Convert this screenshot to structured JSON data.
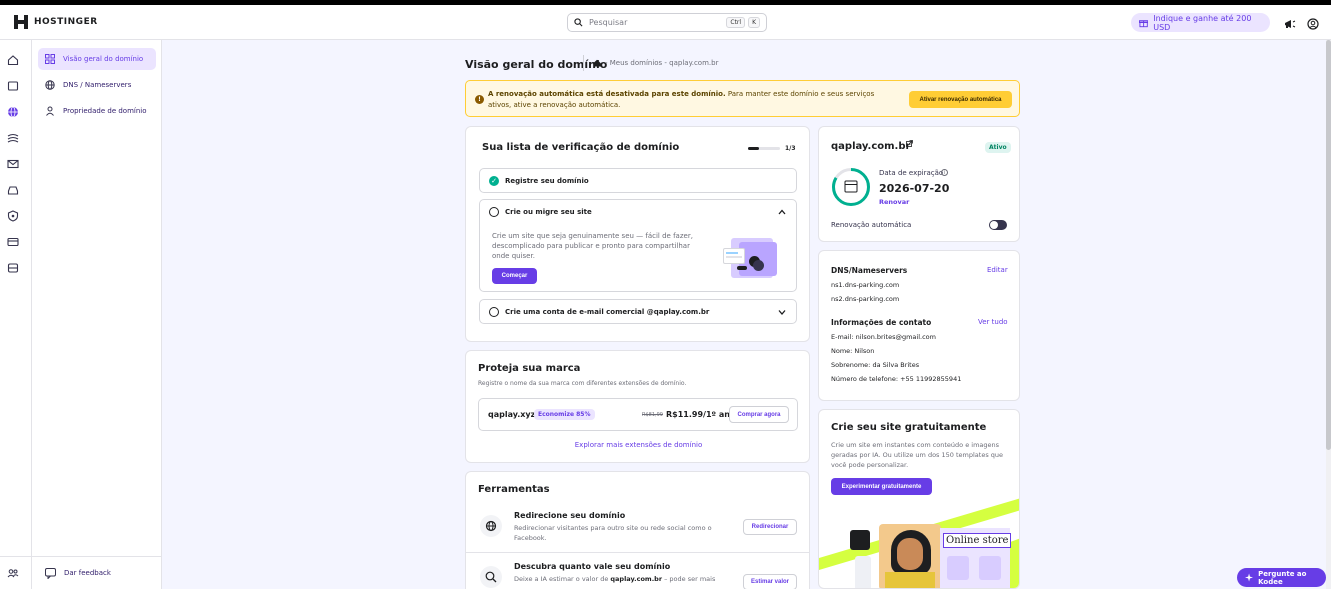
{
  "brand": {
    "name": "HOSTINGER"
  },
  "search": {
    "placeholder": "Pesquisar",
    "kbd1": "Ctrl",
    "kbd2": "K"
  },
  "topbar": {
    "refer_label": "Indique e ganhe até 200 USD"
  },
  "subnav": {
    "items": [
      {
        "label": "Visão geral do domínio",
        "active": true
      },
      {
        "label": "DNS / Nameservers",
        "active": false
      },
      {
        "label": "Propriedade de domínio",
        "active": false
      }
    ],
    "feedback": "Dar feedback"
  },
  "page": {
    "title": "Visão geral do domínio",
    "breadcrumb": "- Meus domínios - qaplay.com.br"
  },
  "alert": {
    "bold": "A renovação automática está desativada para este domínio.",
    "text": " Para manter este domínio e seus serviços ativos, ative a renovação automática.",
    "button": "Ativar renovação automática"
  },
  "checklist": {
    "title": "Sua lista de verificação de domínio",
    "progress_text": "1/3",
    "progress_fraction": 0.33,
    "steps": [
      {
        "label": "Registre seu domínio",
        "done": true
      },
      {
        "label": "Crie ou migre seu site",
        "done": false,
        "description": "Crie um site que seja genuinamente seu — fácil de fazer, descomplicado para publicar e pronto para compartilhar onde quiser.",
        "button": "Começar"
      },
      {
        "label": "Crie uma conta de e-mail comercial @qaplay.com.br",
        "done": false
      }
    ]
  },
  "brand_card": {
    "title": "Proteja sua marca",
    "subtitle": "Registre o nome da sua marca com diferentes extensões de domínio.",
    "domain": "qaplay.xyz",
    "badge": "Economize 85%",
    "old_price": "R$81,99",
    "price": "R$11.99/1º ano",
    "button": "Comprar agora",
    "explore": "Explorar mais extensões de domínio"
  },
  "tools": {
    "title": "Ferramentas",
    "items": [
      {
        "title": "Redirecione seu domínio",
        "desc": "Redirecionar visitantes para outro site ou rede social como o Facebook.",
        "button": "Redirecionar"
      },
      {
        "title": "Descubra quanto vale seu domínio",
        "desc_pre": "Deixe a IA estimar o valor de ",
        "desc_bold": "qaplay.com.br",
        "desc_post": " – pode ser mais",
        "button": "Estimar valor"
      }
    ]
  },
  "domain_card": {
    "domain": "qaplay.com.br",
    "status": "Ativo",
    "expiry_label": "Data de expiração",
    "expiry_date": "2026-07-20",
    "renew": "Renovar",
    "auto_renew_label": "Renovação automática"
  },
  "dns_card": {
    "title": "DNS/Nameservers",
    "edit": "Editar",
    "ns1": "ns1.dns-parking.com",
    "ns2": "ns2.dns-parking.com",
    "contact_title": "Informações de contato",
    "view_all": "Ver tudo",
    "email": "E-mail: nilson.brites@gmail.com",
    "name": "Nome: Nilson",
    "surname": "Sobrenome: da Silva Brites",
    "phone": "Número de telefone: +55 11992855941"
  },
  "site_card": {
    "title": "Crie seu site gratuitamente",
    "desc": "Crie um site em instantes com conteúdo e imagens geradas por IA. Ou utilize um dos 150 templates que você pode personalizar.",
    "button": "Experimentar gratuitamente",
    "promo_text": "Online store"
  },
  "kodee": {
    "label": "Pergunte ao Kodee"
  }
}
